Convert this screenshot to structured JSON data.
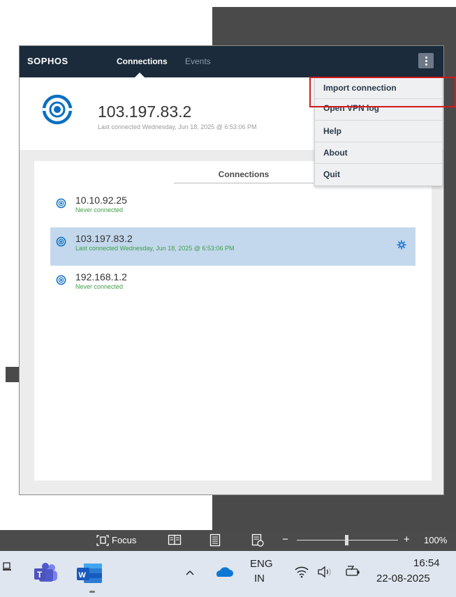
{
  "app": {
    "logo": "SOPHOS",
    "tabs": [
      {
        "label": "Connections",
        "active": true
      },
      {
        "label": "Events",
        "active": false
      }
    ]
  },
  "hero": {
    "ip": "103.197.83.2",
    "status": "Last connected Wednesday, Jun 18, 2025 @ 6:53:06 PM"
  },
  "panel": {
    "title": "Connections",
    "connections": [
      {
        "ip": "10.10.92.25",
        "status": "Never connected",
        "selected": false
      },
      {
        "ip": "103.197.83.2",
        "status": "Last connected Wednesday, Jun 18, 2025 @ 6:53:06 PM",
        "selected": true
      },
      {
        "ip": "192.168.1.2",
        "status": "Never connected",
        "selected": false
      }
    ]
  },
  "menu": {
    "items": [
      "Import connection",
      "Open VPN log",
      "Help",
      "About",
      "Quit"
    ]
  },
  "word_status": {
    "focus_label": "Focus",
    "zoom_minus": "−",
    "zoom_plus": "+",
    "zoom_level": "100%"
  },
  "taskbar": {
    "language_line1": "ENG",
    "language_line2": "IN",
    "time": "16:54",
    "date": "22-08-2025",
    "caret": "^"
  },
  "colors": {
    "header": "#1b2b3b",
    "accent_blue": "#0a6fc2",
    "selected_row": "#c3d8ec",
    "status_green": "#3f9e4a",
    "highlight_red": "#d11a1a"
  }
}
